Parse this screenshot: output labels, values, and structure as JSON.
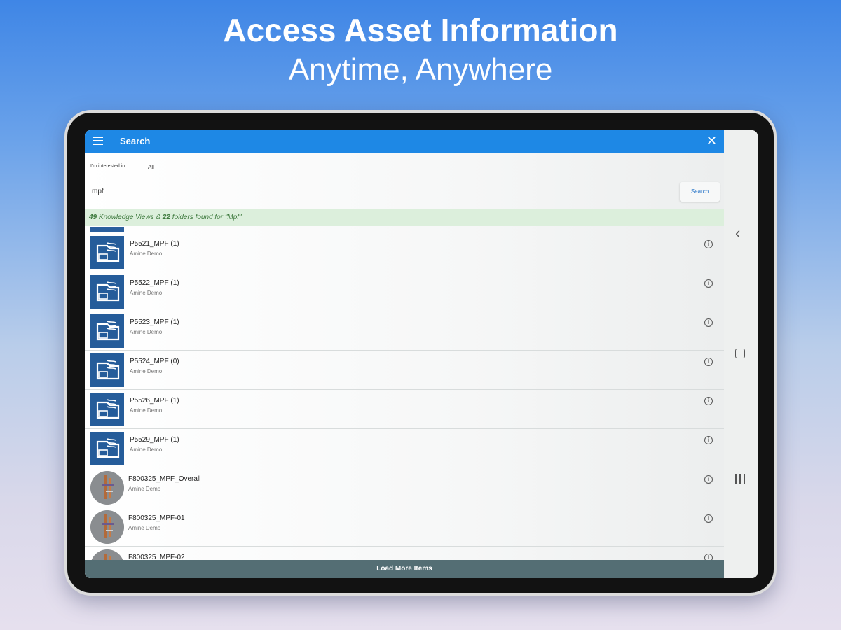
{
  "promo": {
    "title": "Access Asset Information",
    "subtitle": "Anytime, Anywhere"
  },
  "header": {
    "title": "Search",
    "menu_icon": "menu-icon",
    "close_glyph": "✕"
  },
  "filter": {
    "label": "I'm interested in:",
    "value": "All"
  },
  "search": {
    "query": "mpf",
    "button_label": "Search"
  },
  "results_banner": {
    "count_views": "49",
    "text_views": "Knowledge Views &",
    "count_folders": "22",
    "text_folders": "folders found for \"Mpf\""
  },
  "items": [
    {
      "title": "P5521_MPF (1)",
      "owner": "Amine Demo",
      "thumb": "folder"
    },
    {
      "title": "P5522_MPF (1)",
      "owner": "Amine Demo",
      "thumb": "folder"
    },
    {
      "title": "P5523_MPF (1)",
      "owner": "Amine Demo",
      "thumb": "folder"
    },
    {
      "title": "P5524_MPF (0)",
      "owner": "Amine Demo",
      "thumb": "folder"
    },
    {
      "title": "P5526_MPF (1)",
      "owner": "Amine Demo",
      "thumb": "folder"
    },
    {
      "title": "P5529_MPF (1)",
      "owner": "Amine Demo",
      "thumb": "folder"
    },
    {
      "title": "F800325_MPF_Overall",
      "owner": "Amine Demo",
      "thumb": "model"
    },
    {
      "title": "F800325_MPF-01",
      "owner": "Amine Demo",
      "thumb": "model"
    },
    {
      "title": "F800325_MPF-02",
      "owner": "",
      "thumb": "model"
    }
  ],
  "load_more_label": "Load More Items",
  "colors": {
    "app_bar": "#1e88e5",
    "banner_bg": "#dcefdc",
    "folder_thumb": "#255c9a",
    "load_more_bg": "#546e74"
  }
}
